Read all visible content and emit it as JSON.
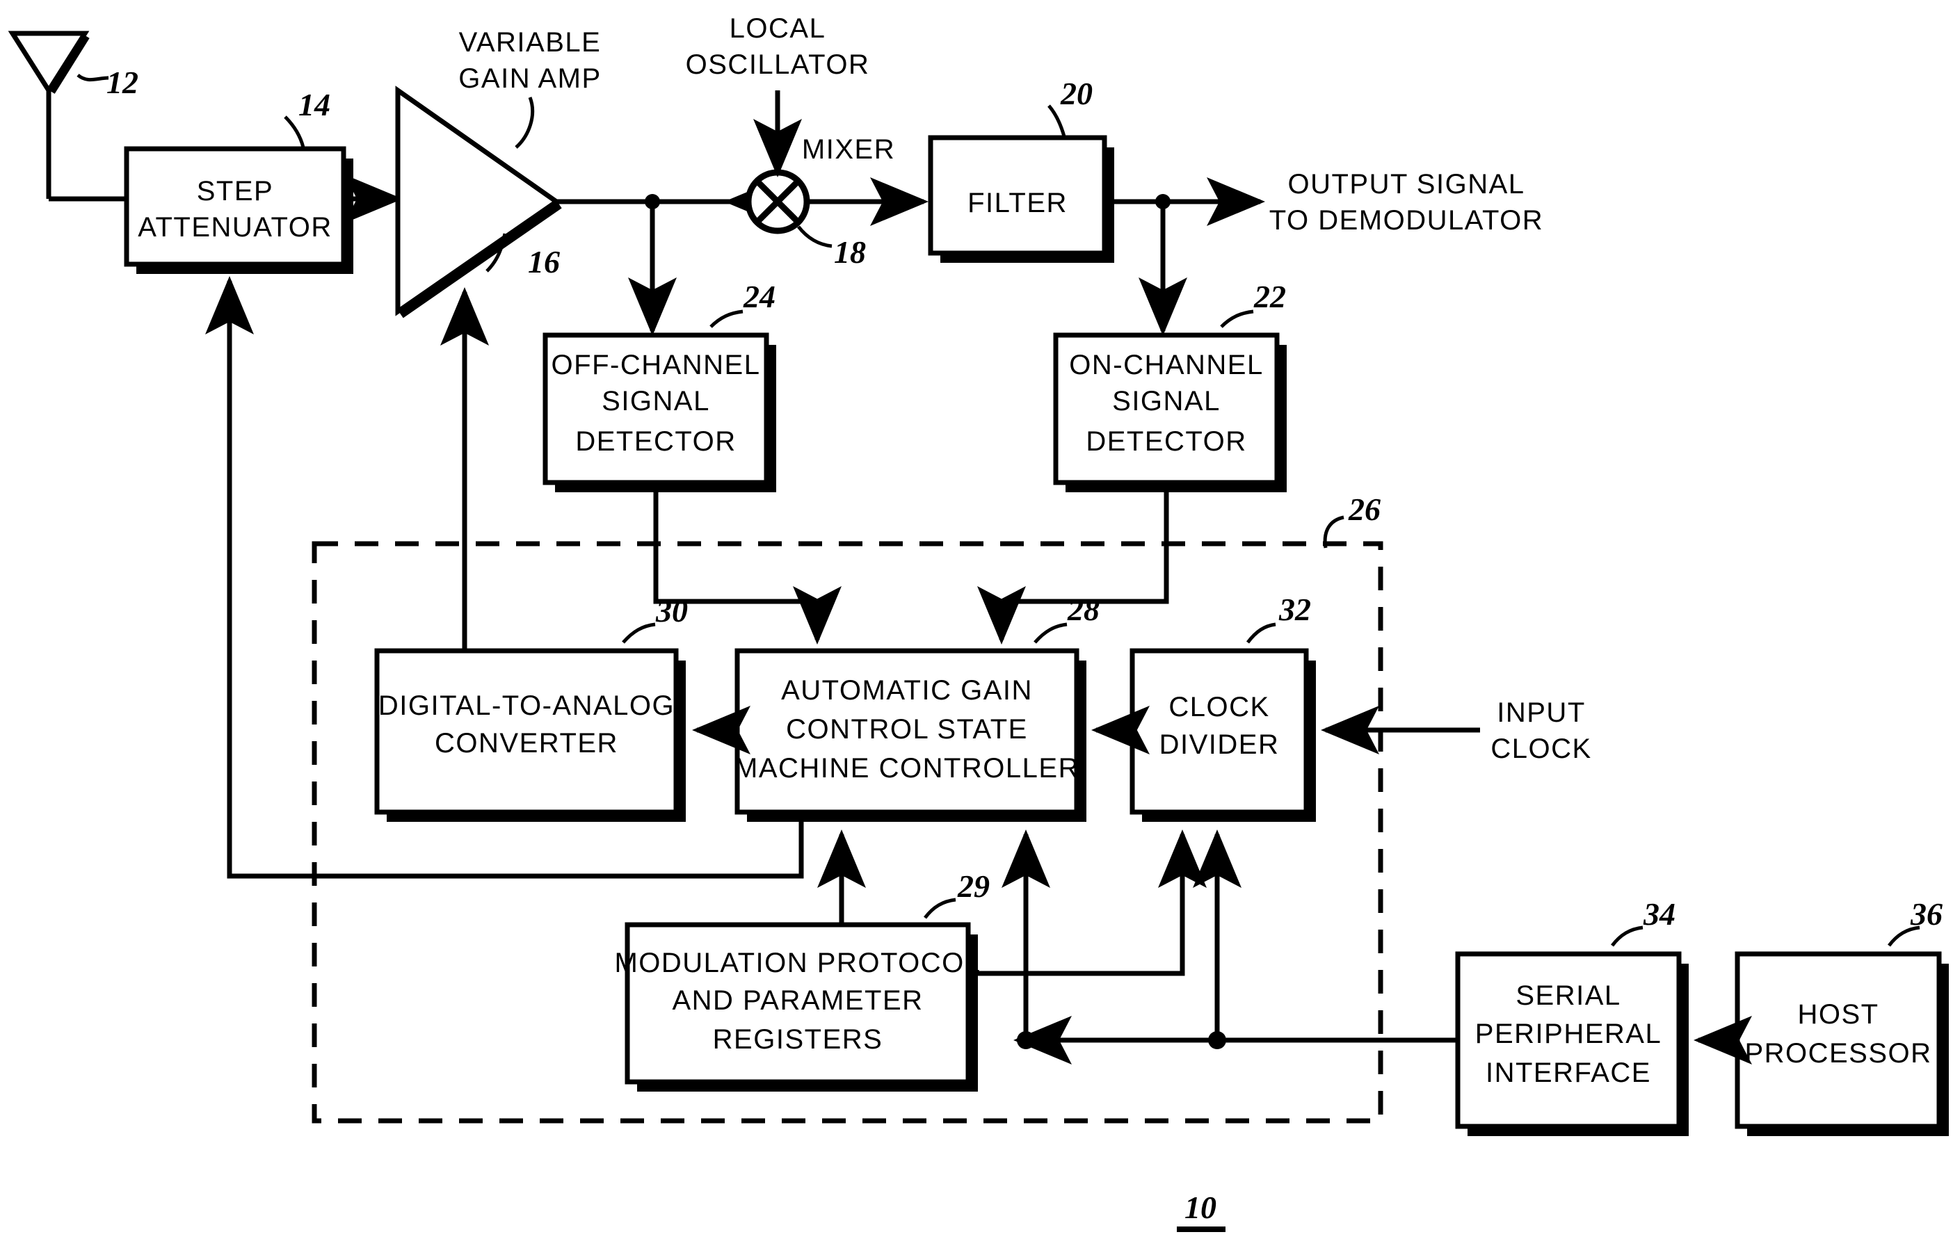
{
  "figure": {
    "number": "10",
    "enclosure_ref": "26"
  },
  "blocks": [
    {
      "id": "step_attenuator",
      "ref": "14",
      "lines": [
        "STEP",
        "ATTENUATOR"
      ]
    },
    {
      "id": "filter",
      "ref": "20",
      "lines": [
        "FILTER"
      ]
    },
    {
      "id": "off_channel",
      "ref": "24",
      "lines": [
        "OFF-CHANNEL",
        "SIGNAL",
        "DETECTOR"
      ]
    },
    {
      "id": "on_channel",
      "ref": "22",
      "lines": [
        "ON-CHANNEL",
        "SIGNAL",
        "DETECTOR"
      ]
    },
    {
      "id": "dac",
      "ref": "30",
      "lines": [
        "DIGITAL-TO-ANALOG",
        "CONVERTER"
      ]
    },
    {
      "id": "agc_controller",
      "ref": "28",
      "lines": [
        "AUTOMATIC GAIN",
        "CONTROL STATE",
        "MACHINE CONTROLLER"
      ]
    },
    {
      "id": "clock_divider",
      "ref": "32",
      "lines": [
        "CLOCK",
        "DIVIDER"
      ]
    },
    {
      "id": "mod_registers",
      "ref": "29",
      "lines": [
        "MODULATION PROTOCOL",
        "AND PARAMETER",
        "REGISTERS"
      ]
    },
    {
      "id": "spi",
      "ref": "34",
      "lines": [
        "SERIAL",
        "PERIPHERAL",
        "INTERFACE"
      ]
    },
    {
      "id": "host_processor",
      "ref": "36",
      "lines": [
        "HOST",
        "PROCESSOR"
      ]
    }
  ],
  "symbols": [
    {
      "id": "antenna",
      "ref": "12",
      "label": ""
    },
    {
      "id": "vga",
      "ref": "16",
      "lines": [
        "VARIABLE",
        "GAIN AMP"
      ]
    },
    {
      "id": "mixer",
      "ref": "18",
      "label": "MIXER"
    }
  ],
  "annotations": {
    "local_oscillator": [
      "LOCAL",
      "OSCILLATOR"
    ],
    "mixer_label": "MIXER",
    "vga_label": [
      "VARIABLE",
      "GAIN AMP"
    ],
    "output_signal": [
      "OUTPUT SIGNAL",
      "TO DEMODULATOR"
    ],
    "input_clock": [
      "INPUT",
      "CLOCK"
    ]
  },
  "refs": {
    "antenna": "12",
    "step_attenuator": "14",
    "vga": "16",
    "mixer": "18",
    "filter": "20",
    "on_channel": "22",
    "off_channel": "24",
    "enclosure": "26",
    "agc_controller": "28",
    "mod_registers": "29",
    "dac": "30",
    "clock_divider": "32",
    "spi": "34",
    "host_processor": "36",
    "figure": "10"
  },
  "colors": {
    "stroke": "#000000",
    "fill": "#ffffff",
    "shadow": "#000000"
  }
}
